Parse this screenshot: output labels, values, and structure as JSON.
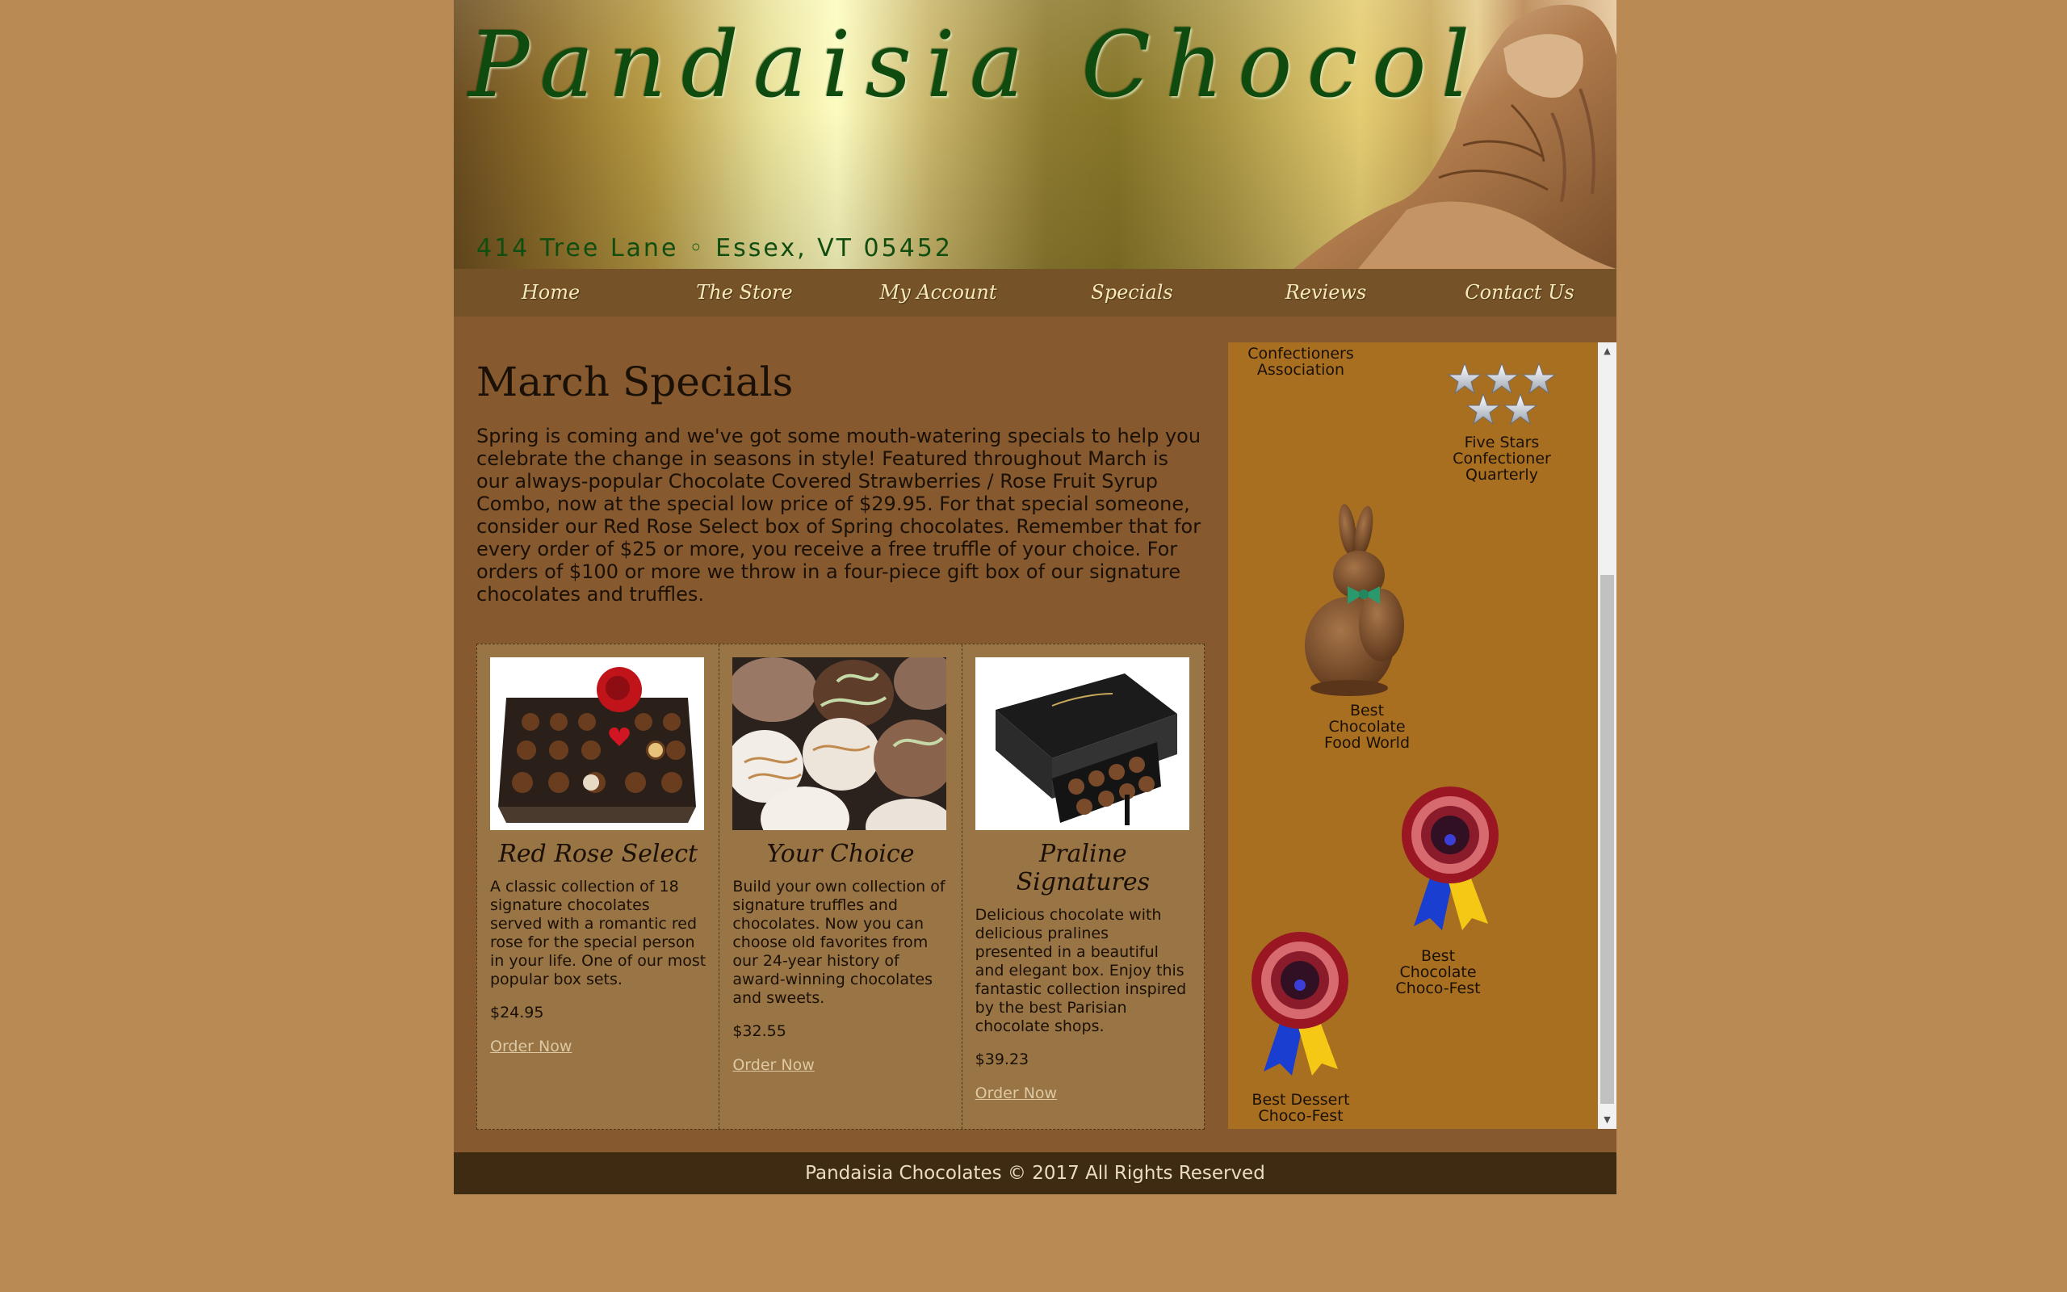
{
  "header": {
    "brand": "Pandaisia Chocolates",
    "address": "414 Tree Lane ◦ Essex, VT 05452"
  },
  "nav": {
    "items": [
      {
        "label": "Home"
      },
      {
        "label": "The Store"
      },
      {
        "label": "My Account"
      },
      {
        "label": "Specials"
      },
      {
        "label": "Reviews"
      },
      {
        "label": "Contact Us"
      }
    ]
  },
  "main": {
    "title": "March Specials",
    "intro": "Spring is coming and we've got some mouth-watering specials to help you celebrate the change in seasons in style! Featured throughout March is our always-popular Chocolate Covered Strawberries / Rose Fruit Syrup Combo, now at the special low price of $29.95. For that special someone, consider our Red Rose Select box of Spring chocolates. Remember that for every order of $25 or more, you receive a free truffle of your choice. For orders of $100 or more we throw in a four-piece gift box of our signature chocolates and truffles."
  },
  "products": [
    {
      "name": "Red Rose Select",
      "description": "A classic collection of 18 signature chocolates served with a romantic red rose for the special person in your life. One of our most popular box sets.",
      "price": "$24.95",
      "order_label": "Order Now"
    },
    {
      "name": "Your Choice",
      "description": "Build your own collection of signature truffles and chocolates. Now you can choose old favorites from our 24-year history of award-winning chocolates and sweets.",
      "price": "$32.55",
      "order_label": "Order Now"
    },
    {
      "name": "Praline Signatures",
      "description": "Delicious chocolate with delicious pralines presented in a beautiful and elegant box. Enjoy this fantastic collection inspired by the best Parisian chocolate shops.",
      "price": "$39.23",
      "order_label": "Order Now"
    }
  ],
  "awards": {
    "confectioners": {
      "line1": "Confectioners",
      "line2": "Association"
    },
    "five_stars": {
      "line1": "Five Stars",
      "line2": "Confectioner",
      "line3": "Quarterly"
    },
    "food_world": {
      "line1": "Best",
      "line2": "Chocolate",
      "line3": "Food World"
    },
    "choco_fest": {
      "line1": "Best",
      "line2": "Chocolate",
      "line3": "Choco-Fest"
    },
    "dessert": {
      "line1": "Best Dessert",
      "line2": "Choco-Fest"
    }
  },
  "footer": {
    "text": "Pandaisia Chocolates © 2017 All Rights Reserved"
  }
}
